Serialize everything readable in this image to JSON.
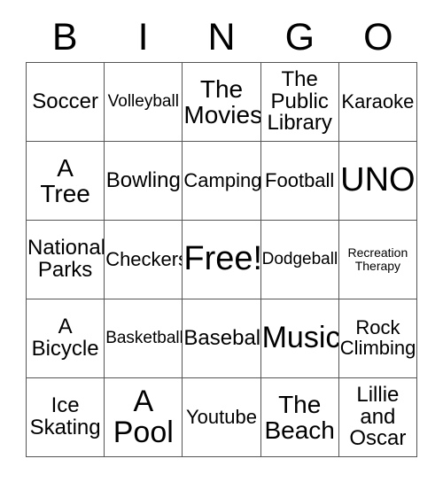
{
  "card": {
    "header_letters": [
      "B",
      "I",
      "N",
      "G",
      "O"
    ],
    "rows": [
      [
        {
          "text": "Soccer",
          "size": "md"
        },
        {
          "text": "Volleyball",
          "size": "xs"
        },
        {
          "text": "The\nMovies",
          "size": "lg"
        },
        {
          "text": "The\nPublic\nLibrary",
          "size": "md"
        },
        {
          "text": "Karaoke",
          "size": "sm"
        }
      ],
      [
        {
          "text": "A\nTree",
          "size": "lg"
        },
        {
          "text": "Bowling",
          "size": "md"
        },
        {
          "text": "Camping",
          "size": "sm"
        },
        {
          "text": "Football",
          "size": "sm"
        },
        {
          "text": "UNO",
          "size": "xxl"
        }
      ],
      [
        {
          "text": "National\nParks",
          "size": "md"
        },
        {
          "text": "Checkers",
          "size": "sm"
        },
        {
          "text": "Free!",
          "size": "xxl"
        },
        {
          "text": "Dodgeball",
          "size": "xs"
        },
        {
          "text": "Recreation\nTherapy",
          "size": "xxs"
        }
      ],
      [
        {
          "text": "A\nBicycle",
          "size": "md"
        },
        {
          "text": "Basketball",
          "size": "xs"
        },
        {
          "text": "Baseball",
          "size": "md"
        },
        {
          "text": "Music",
          "size": "xl"
        },
        {
          "text": "Rock\nClimbing",
          "size": "sm"
        }
      ],
      [
        {
          "text": "Ice\nSkating",
          "size": "md"
        },
        {
          "text": "A\nPool",
          "size": "xl"
        },
        {
          "text": "Youtube",
          "size": "sm"
        },
        {
          "text": "The\nBeach",
          "size": "lg"
        },
        {
          "text": "Lillie\nand\nOscar",
          "size": "md"
        }
      ]
    ]
  },
  "colors": {
    "background": "#ffffff",
    "text": "#000000",
    "border": "#555555"
  }
}
